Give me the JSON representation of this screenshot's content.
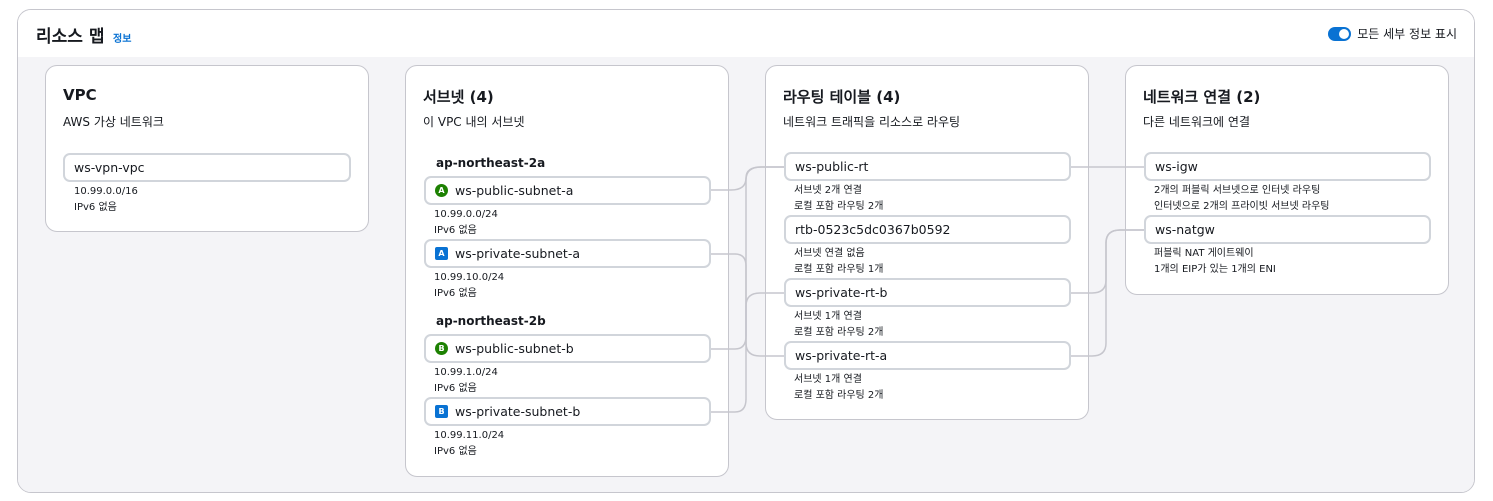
{
  "header": {
    "title": "리소스 맵",
    "info": "정보",
    "toggle_label": "모든 세부 정보 표시"
  },
  "vpc": {
    "title": "VPC",
    "subtitle": "AWS 가상 네트워크",
    "name": "ws-vpn-vpc",
    "cidr": "10.99.0.0/16",
    "ipv6": "IPv6 없음"
  },
  "subnets": {
    "title": "서브넷 (4)",
    "subtitle": "이 VPC 내의 서브넷",
    "az_a": "ap-northeast-2a",
    "az_b": "ap-northeast-2b",
    "items": [
      {
        "badge": "A",
        "name": "ws-public-subnet-a",
        "cidr": "10.99.0.0/24",
        "ipv6": "IPv6 없음"
      },
      {
        "badge": "A",
        "name": "ws-private-subnet-a",
        "cidr": "10.99.10.0/24",
        "ipv6": "IPv6 없음"
      },
      {
        "badge": "B",
        "name": "ws-public-subnet-b",
        "cidr": "10.99.1.0/24",
        "ipv6": "IPv6 없음"
      },
      {
        "badge": "B",
        "name": "ws-private-subnet-b",
        "cidr": "10.99.11.0/24",
        "ipv6": "IPv6 없음"
      }
    ]
  },
  "route_tables": {
    "title": "라우팅 테이블 (4)",
    "subtitle": "네트워크 트래픽을 리소스로 라우팅",
    "items": [
      {
        "name": "ws-public-rt",
        "line1": "서브넷 2개 연결",
        "line2": "로컬 포함 라우팅 2개"
      },
      {
        "name": "rtb-0523c5dc0367b0592",
        "line1": "서브넷 연결 없음",
        "line2": "로컬 포함 라우팅 1개"
      },
      {
        "name": "ws-private-rt-b",
        "line1": "서브넷 1개 연결",
        "line2": "로컬 포함 라우팅 2개"
      },
      {
        "name": "ws-private-rt-a",
        "line1": "서브넷 1개 연결",
        "line2": "로컬 포함 라우팅 2개"
      }
    ]
  },
  "connections": {
    "title": "네트워크 연결 (2)",
    "subtitle": "다른 네트워크에 연결",
    "items": [
      {
        "name": "ws-igw",
        "line1": "2개의 퍼블릭 서브넷으로 인터넷 라우팅",
        "line2": "인터넷으로 2개의 프라이빗 서브넷 라우팅"
      },
      {
        "name": "ws-natgw",
        "line1": "퍼블릭 NAT 게이트웨이",
        "line2": "1개의 EIP가 있는 1개의 ENI"
      }
    ]
  },
  "colors": {
    "accent": "#0972d3",
    "public_badge": "#1d8102",
    "private_badge": "#0972d3",
    "connector": "#c6c6cd"
  }
}
